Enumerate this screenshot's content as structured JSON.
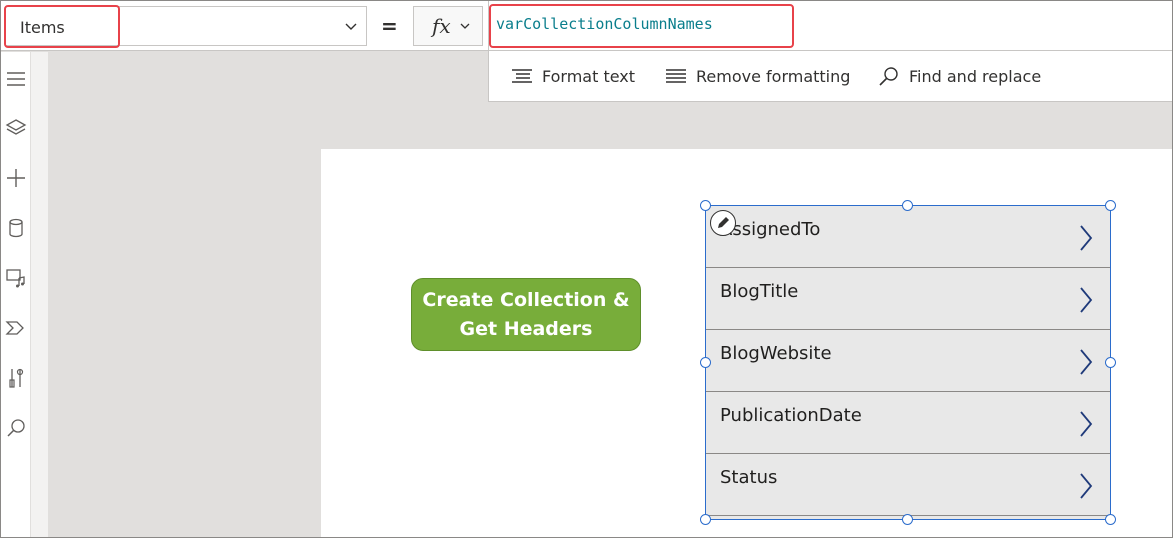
{
  "formula_bar": {
    "property": "Items",
    "equals": "=",
    "fx_label": "fx",
    "formula": "varCollectionColumnNames"
  },
  "format_toolbar": {
    "format_text": "Format text",
    "remove_formatting": "Remove formatting",
    "find_replace": "Find and replace"
  },
  "left_rail": {
    "icons": [
      "hamburger-icon",
      "layers-icon",
      "add-icon",
      "database-icon",
      "media-icon",
      "power-automate-icon",
      "tools-icon",
      "search-icon"
    ]
  },
  "canvas": {
    "button_label": "Create Collection & Get Headers",
    "button_color": "#78ad3a",
    "gallery_items": [
      "AssignedTo",
      "BlogTitle",
      "BlogWebsite",
      "PublicationDate",
      "Status"
    ],
    "selection_color": "#2b6ccc",
    "highlight_color": "#e8424a"
  }
}
